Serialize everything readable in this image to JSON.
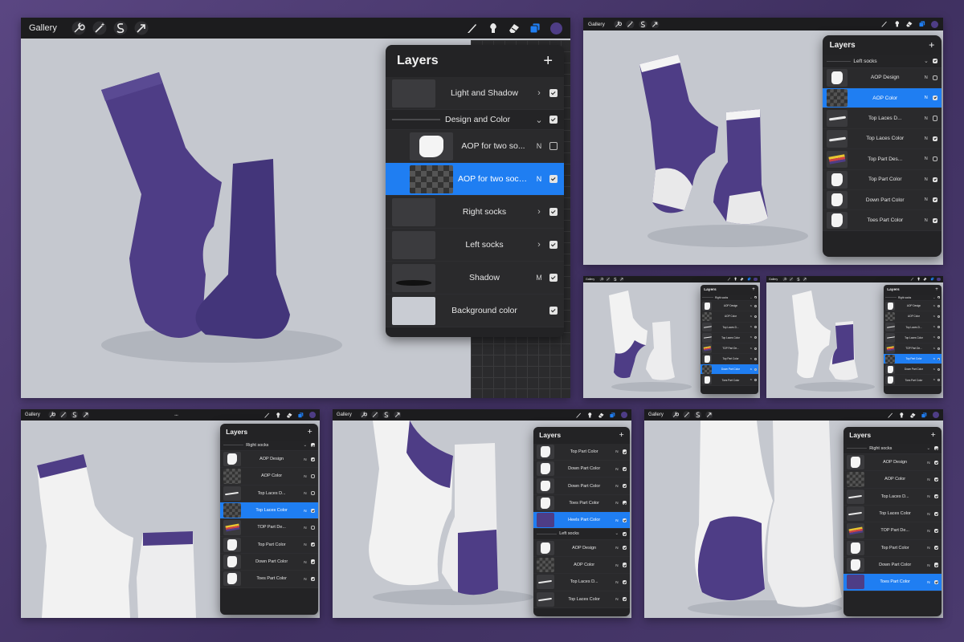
{
  "colors": {
    "sock_purple": "#4e3d86",
    "selected_row": "#1f7ef2",
    "toolbar": "#1c1c1e",
    "canvas_bg": "#c5c8cf",
    "panel_bg": "#232325"
  },
  "toolbar": {
    "gallery_label": "Gallery",
    "more_label": "•••",
    "tools": [
      "wrench-icon",
      "magic-wand-icon",
      "selection-s-icon",
      "transform-arrow-icon",
      "brush-icon",
      "smudge-icon",
      "eraser-icon",
      "layers-icon",
      "color-dot"
    ]
  },
  "panels": {
    "main": {
      "title": "Layers",
      "add_label": "+",
      "rows": [
        {
          "name": "Light and Shadow",
          "mode": "",
          "checked": true,
          "kind": "group-collapsed",
          "thumb": "blk"
        },
        {
          "name": "Design and Color",
          "mode": "",
          "checked": true,
          "kind": "group-open",
          "thumb": ""
        },
        {
          "name": "AOP for two so...",
          "mode": "N",
          "checked": false,
          "kind": "layer",
          "thumb": "wht"
        },
        {
          "name": "AOP for two sock...",
          "mode": "N",
          "checked": true,
          "kind": "layer",
          "thumb": "chk",
          "selected": true
        },
        {
          "name": "Right socks",
          "mode": "",
          "checked": true,
          "kind": "group-collapsed",
          "thumb": "blk"
        },
        {
          "name": "Left socks",
          "mode": "",
          "checked": true,
          "kind": "group-collapsed",
          "thumb": "blk"
        },
        {
          "name": "Shadow",
          "mode": "M",
          "checked": true,
          "kind": "layer",
          "thumb": "sh"
        },
        {
          "name": "Background color",
          "mode": "",
          "checked": true,
          "kind": "layer",
          "thumb": "bg"
        }
      ]
    },
    "p2": {
      "title": "Layers",
      "add_label": "+",
      "rows": [
        {
          "name": "Left socks",
          "mode": "",
          "checked": true,
          "kind": "group-open",
          "thumb": ""
        },
        {
          "name": "AOP Design",
          "mode": "N",
          "checked": false,
          "kind": "layer",
          "thumb": "wht"
        },
        {
          "name": "AOP Color",
          "mode": "N",
          "checked": true,
          "kind": "layer",
          "thumb": "chk",
          "selected": true
        },
        {
          "name": "Top Laces D...",
          "mode": "N",
          "checked": false,
          "kind": "layer",
          "thumb": "strk"
        },
        {
          "name": "Top Laces Color",
          "mode": "N",
          "checked": true,
          "kind": "layer",
          "thumb": "strk"
        },
        {
          "name": "Top Part Des...",
          "mode": "N",
          "checked": false,
          "kind": "layer",
          "thumb": "mix"
        },
        {
          "name": "Top Part Color",
          "mode": "N",
          "checked": true,
          "kind": "layer",
          "thumb": "wht"
        },
        {
          "name": "Down Part Color",
          "mode": "N",
          "checked": true,
          "kind": "layer",
          "thumb": "wht"
        },
        {
          "name": "Toes Part Color",
          "mode": "N",
          "checked": true,
          "kind": "layer",
          "thumb": "wht"
        }
      ]
    },
    "p3": {
      "title": "Layers",
      "add_label": "+",
      "rows": [
        {
          "name": "Right socks",
          "mode": "",
          "checked": true,
          "kind": "group-open",
          "thumb": ""
        },
        {
          "name": "AOP Design",
          "mode": "N",
          "checked": false,
          "kind": "layer",
          "thumb": "wht"
        },
        {
          "name": "AOP Color",
          "mode": "N",
          "checked": false,
          "kind": "layer",
          "thumb": "chk"
        },
        {
          "name": "Top Laces D...",
          "mode": "N",
          "checked": false,
          "kind": "layer",
          "thumb": "strk"
        },
        {
          "name": "Top Laces Color",
          "mode": "N",
          "checked": false,
          "kind": "layer",
          "thumb": "strk"
        },
        {
          "name": "TOP Part De...",
          "mode": "N",
          "checked": false,
          "kind": "layer",
          "thumb": "mix"
        },
        {
          "name": "Top Part Color",
          "mode": "N",
          "checked": false,
          "kind": "layer",
          "thumb": "wht"
        },
        {
          "name": "Down Part Color",
          "mode": "N",
          "checked": false,
          "kind": "layer",
          "thumb": "chk",
          "selected": true
        },
        {
          "name": "Toes Part Color",
          "mode": "N",
          "checked": false,
          "kind": "layer",
          "thumb": "wht"
        }
      ]
    },
    "p4": {
      "title": "Layers",
      "add_label": "+",
      "rows": [
        {
          "name": "Right socks",
          "mode": "",
          "checked": true,
          "kind": "group-open",
          "thumb": ""
        },
        {
          "name": "AOP Design",
          "mode": "N",
          "checked": false,
          "kind": "layer",
          "thumb": "wht"
        },
        {
          "name": "AOP Color",
          "mode": "N",
          "checked": false,
          "kind": "layer",
          "thumb": "chk"
        },
        {
          "name": "Top Laces D...",
          "mode": "N",
          "checked": false,
          "kind": "layer",
          "thumb": "strk"
        },
        {
          "name": "Top Laces Color",
          "mode": "N",
          "checked": false,
          "kind": "layer",
          "thumb": "strk"
        },
        {
          "name": "TOP Part De...",
          "mode": "N",
          "checked": false,
          "kind": "layer",
          "thumb": "mix"
        },
        {
          "name": "Top Part Color",
          "mode": "N",
          "checked": true,
          "kind": "layer",
          "thumb": "chk",
          "selected": true
        },
        {
          "name": "Down Part Color",
          "mode": "N",
          "checked": false,
          "kind": "layer",
          "thumb": "wht"
        },
        {
          "name": "Toes Part Color",
          "mode": "N",
          "checked": false,
          "kind": "layer",
          "thumb": "wht"
        }
      ]
    },
    "p5": {
      "title": "Layers",
      "add_label": "+",
      "rows": [
        {
          "name": "Right socks",
          "mode": "",
          "checked": true,
          "kind": "group-open",
          "thumb": ""
        },
        {
          "name": "AOP Design",
          "mode": "N",
          "checked": true,
          "kind": "layer",
          "thumb": "wht"
        },
        {
          "name": "AOP Color",
          "mode": "N",
          "checked": false,
          "kind": "layer",
          "thumb": "chk"
        },
        {
          "name": "Top Laces D...",
          "mode": "N",
          "checked": false,
          "kind": "layer",
          "thumb": "strk"
        },
        {
          "name": "Top Laces Color",
          "mode": "N",
          "checked": true,
          "kind": "layer",
          "thumb": "chk",
          "selected": true
        },
        {
          "name": "TOP Part De...",
          "mode": "N",
          "checked": false,
          "kind": "layer",
          "thumb": "mix"
        },
        {
          "name": "Top Part Color",
          "mode": "N",
          "checked": true,
          "kind": "layer",
          "thumb": "wht"
        },
        {
          "name": "Down Part Color",
          "mode": "N",
          "checked": true,
          "kind": "layer",
          "thumb": "wht"
        },
        {
          "name": "Toes Part Color",
          "mode": "N",
          "checked": true,
          "kind": "layer",
          "thumb": "wht"
        }
      ]
    },
    "p6": {
      "title": "Layers",
      "add_label": "+",
      "rows": [
        {
          "name": "Top Part Color",
          "mode": "N",
          "checked": true,
          "kind": "layer",
          "thumb": "wht"
        },
        {
          "name": "Down Part Color",
          "mode": "N",
          "checked": true,
          "kind": "layer",
          "thumb": "wht"
        },
        {
          "name": "Down Part Color",
          "mode": "N",
          "checked": true,
          "kind": "layer",
          "thumb": "wht"
        },
        {
          "name": "Toes Part Color",
          "mode": "N",
          "checked": true,
          "kind": "layer",
          "thumb": "wht"
        },
        {
          "name": "Heels Part Color",
          "mode": "N",
          "checked": true,
          "kind": "layer",
          "thumb": "pur",
          "selected": true
        },
        {
          "name": "Left socks",
          "mode": "",
          "checked": true,
          "kind": "group-open",
          "thumb": ""
        },
        {
          "name": "AOP Design",
          "mode": "N",
          "checked": true,
          "kind": "layer",
          "thumb": "wht"
        },
        {
          "name": "AOP Color",
          "mode": "N",
          "checked": true,
          "kind": "layer",
          "thumb": "chk"
        },
        {
          "name": "Top Laces D...",
          "mode": "N",
          "checked": true,
          "kind": "layer",
          "thumb": "strk"
        },
        {
          "name": "Top Laces Color",
          "mode": "N",
          "checked": true,
          "kind": "layer",
          "thumb": "strk"
        }
      ]
    },
    "p7": {
      "title": "Layers",
      "add_label": "+",
      "rows": [
        {
          "name": "Right socks",
          "mode": "",
          "checked": true,
          "kind": "group-open",
          "thumb": ""
        },
        {
          "name": "AOP Design",
          "mode": "N",
          "checked": true,
          "kind": "layer",
          "thumb": "wht"
        },
        {
          "name": "AOP Color",
          "mode": "N",
          "checked": true,
          "kind": "layer",
          "thumb": "chk"
        },
        {
          "name": "Top Laces D...",
          "mode": "N",
          "checked": true,
          "kind": "layer",
          "thumb": "strk"
        },
        {
          "name": "Top Laces Color",
          "mode": "N",
          "checked": true,
          "kind": "layer",
          "thumb": "strk"
        },
        {
          "name": "TOP Part De...",
          "mode": "N",
          "checked": true,
          "kind": "layer",
          "thumb": "mix"
        },
        {
          "name": "Top Part Color",
          "mode": "N",
          "checked": true,
          "kind": "layer",
          "thumb": "wht"
        },
        {
          "name": "Down Part Color",
          "mode": "N",
          "checked": true,
          "kind": "layer",
          "thumb": "wht"
        },
        {
          "name": "Toes Part Color",
          "mode": "N",
          "checked": true,
          "kind": "layer",
          "thumb": "pur",
          "selected": true
        }
      ]
    }
  }
}
